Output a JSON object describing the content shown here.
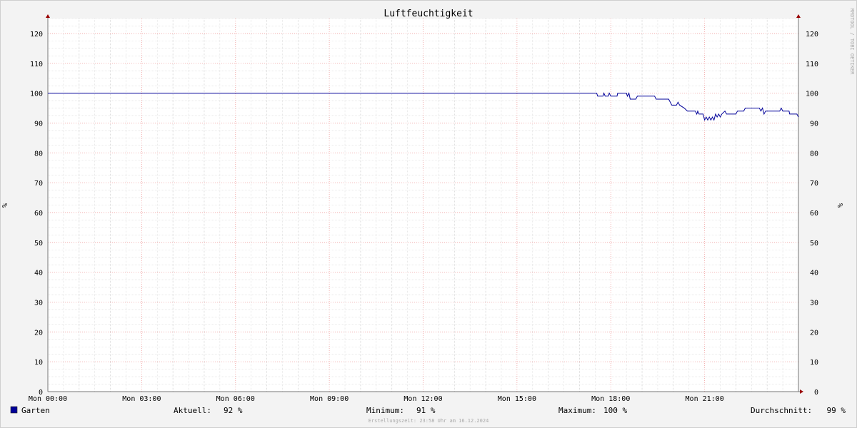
{
  "chart_data": {
    "type": "line",
    "title": "Luftfeuchtigkeit",
    "ylabel": "%",
    "watermark": "RRDTOOL / TOBI OETIKER",
    "ylim": [
      0,
      125
    ],
    "xlim_hours": [
      0,
      24
    ],
    "y_ticks": [
      0,
      10,
      20,
      30,
      40,
      50,
      60,
      70,
      80,
      90,
      100,
      110,
      120
    ],
    "x_ticks": [
      {
        "hour": 0,
        "label": "Mon 00:00"
      },
      {
        "hour": 3,
        "label": "Mon 03:00"
      },
      {
        "hour": 6,
        "label": "Mon 06:00"
      },
      {
        "hour": 9,
        "label": "Mon 09:00"
      },
      {
        "hour": 12,
        "label": "Mon 12:00"
      },
      {
        "hour": 15,
        "label": "Mon 15:00"
      },
      {
        "hour": 18,
        "label": "Mon 18:00"
      },
      {
        "hour": 21,
        "label": "Mon 21:00"
      }
    ],
    "grid": true,
    "series": [
      {
        "name": "Garten",
        "color": "#000099",
        "points": [
          [
            0,
            100
          ],
          [
            17.55,
            100
          ],
          [
            17.58,
            99
          ],
          [
            17.75,
            99
          ],
          [
            17.78,
            100
          ],
          [
            17.82,
            99
          ],
          [
            17.92,
            99
          ],
          [
            17.95,
            100
          ],
          [
            18.0,
            99
          ],
          [
            18.2,
            99
          ],
          [
            18.22,
            100
          ],
          [
            18.5,
            100
          ],
          [
            18.53,
            99
          ],
          [
            18.58,
            100
          ],
          [
            18.62,
            98
          ],
          [
            18.8,
            98
          ],
          [
            18.85,
            99
          ],
          [
            19.4,
            99
          ],
          [
            19.45,
            98
          ],
          [
            19.85,
            98
          ],
          [
            19.9,
            97
          ],
          [
            19.95,
            96
          ],
          [
            20.1,
            96
          ],
          [
            20.15,
            97
          ],
          [
            20.2,
            96
          ],
          [
            20.35,
            95
          ],
          [
            20.45,
            94
          ],
          [
            20.7,
            94
          ],
          [
            20.75,
            93
          ],
          [
            20.78,
            94
          ],
          [
            20.82,
            93
          ],
          [
            20.95,
            93
          ],
          [
            21.0,
            91
          ],
          [
            21.05,
            92
          ],
          [
            21.1,
            91
          ],
          [
            21.15,
            92
          ],
          [
            21.2,
            91
          ],
          [
            21.25,
            92
          ],
          [
            21.3,
            91
          ],
          [
            21.35,
            93
          ],
          [
            21.4,
            92
          ],
          [
            21.45,
            93
          ],
          [
            21.5,
            92
          ],
          [
            21.55,
            93
          ],
          [
            21.65,
            94
          ],
          [
            21.7,
            93
          ],
          [
            22.0,
            93
          ],
          [
            22.05,
            94
          ],
          [
            22.25,
            94
          ],
          [
            22.3,
            95
          ],
          [
            22.75,
            95
          ],
          [
            22.8,
            94
          ],
          [
            22.85,
            95
          ],
          [
            22.9,
            93
          ],
          [
            22.95,
            94
          ],
          [
            23.4,
            94
          ],
          [
            23.45,
            95
          ],
          [
            23.5,
            94
          ],
          [
            23.7,
            94
          ],
          [
            23.72,
            93
          ],
          [
            23.95,
            93
          ],
          [
            24.0,
            92
          ]
        ]
      }
    ]
  },
  "legend": {
    "series_name": "Garten",
    "swatch_color": "#000099",
    "current_label": "Aktuell:",
    "current_value": "92 %",
    "min_label": "Minimum:",
    "min_value": "91 %",
    "max_label": "Maximum:",
    "max_value": "100 %",
    "avg_label": "Durchschnitt:",
    "avg_value": "99 %"
  },
  "footer": {
    "created": "Erstellungszeit: 23:58 Uhr am 16.12.2024"
  }
}
